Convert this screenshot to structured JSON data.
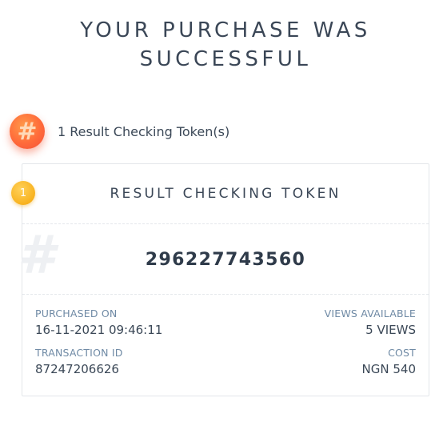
{
  "header": {
    "title_line1": "YOUR PURCHASE WAS",
    "title_line2": "SUCCESSFUL"
  },
  "summary": {
    "icon": "hash-icon",
    "icon_glyph": "#",
    "text": "1 Result Checking Token(s)"
  },
  "token_card": {
    "badge_number": "1",
    "title": "RESULT CHECKING TOKEN",
    "background_glyph": "#",
    "token_value": "296227743560",
    "purchased_on_label": "PURCHASED ON",
    "purchased_on_value": "16-11-2021 09:46:11",
    "views_available_label": "VIEWS AVAILABLE",
    "views_available_value": "5 VIEWS",
    "transaction_id_label": "TRANSACTION ID",
    "transaction_id_value": "87247206626",
    "cost_label": "COST",
    "cost_value": "NGN 540"
  },
  "colors": {
    "hash_badge": "#f4513a",
    "number_badge": "#f8b21e",
    "label_text": "#6f8aa5",
    "body_text": "#3b4857"
  }
}
